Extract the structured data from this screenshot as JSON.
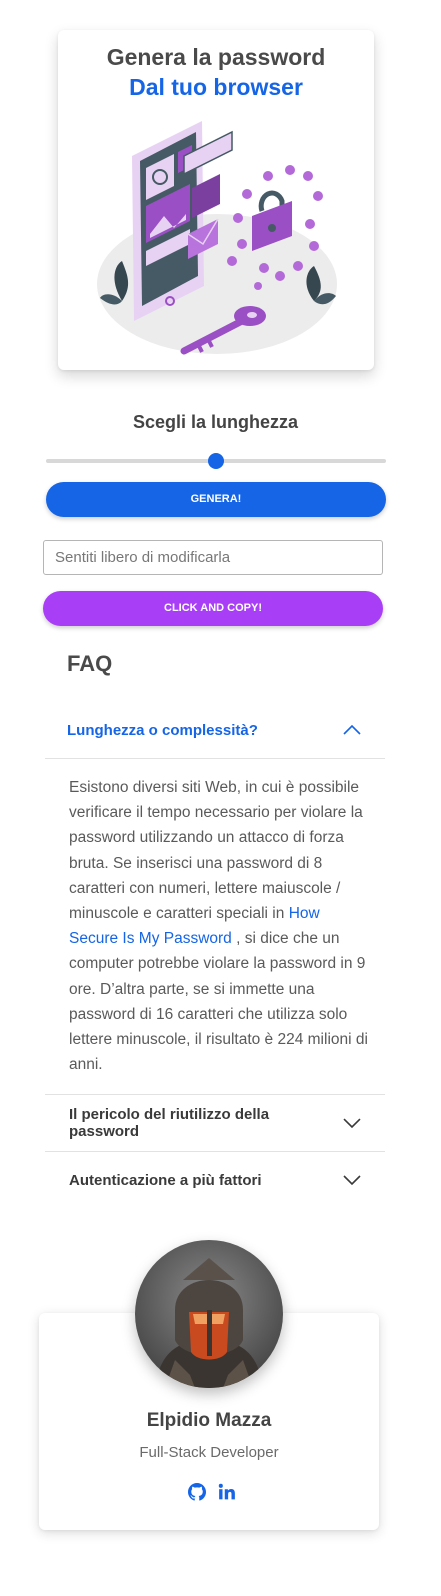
{
  "hero": {
    "title": "Genera la password",
    "subtitle": "Dal tuo browser"
  },
  "generator": {
    "length_title": "Scegli la lunghezza",
    "slider_value_fraction": 0.5,
    "generate_label": "GENERA!",
    "password_value": "",
    "password_placeholder": "Sentiti libero di modificarla",
    "copy_label": "CLICK AND COPY!"
  },
  "faq": {
    "title": "FAQ",
    "items": [
      {
        "question": "Lunghezza o complessità?",
        "expanded": true,
        "answer_before_link": "Esistono diversi siti Web, in cui è possibile verificare il tempo necessario per violare la password utilizzando un attacco di forza bruta. Se inserisci una password di 8 caratteri con numeri, lettere maiuscole / minuscole e caratteri speciali in ",
        "answer_link": "How Secure Is My Password",
        "answer_after_link": " , si dice che un computer potrebbe violare la password in 9 ore. D’altra parte, se si immette una password di 16 caratteri che utilizza solo lettere minuscole, il risultato è 224 milioni di anni."
      },
      {
        "question": "Il pericolo del riutilizzo della password",
        "expanded": false
      },
      {
        "question": "Autenticazione a più fattori",
        "expanded": false
      }
    ]
  },
  "profile": {
    "name": "Elpidio Mazza",
    "role": "Full-Stack Developer",
    "socials": [
      "github-icon",
      "linkedin-icon"
    ]
  },
  "colors": {
    "accent_blue": "#1565e6",
    "accent_purple": "#a93ef7",
    "illustration_purple": "#9b4fc4"
  }
}
